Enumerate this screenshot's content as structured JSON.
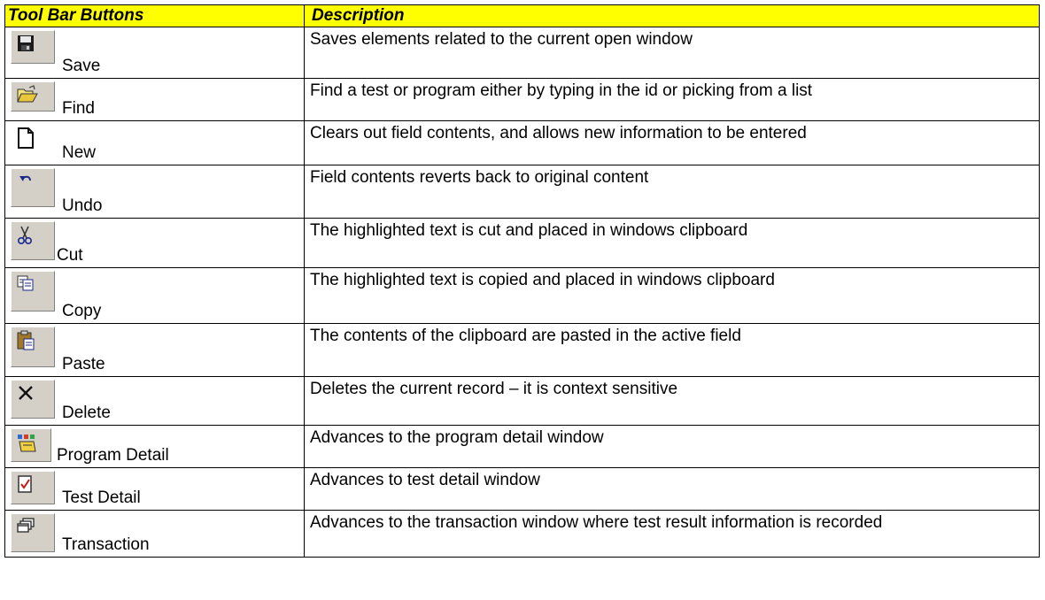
{
  "header": {
    "col_tool": "Tool Bar Buttons",
    "col_desc": "Description"
  },
  "rows": [
    {
      "name": "Save",
      "icon": "floppy-disk-icon",
      "desc": "Saves elements related to the current open window"
    },
    {
      "name": "Find",
      "icon": "open-folder-icon",
      "desc": "Find a test or program either by typing in the id or picking from a list"
    },
    {
      "name": "New",
      "icon": "new-document-icon",
      "desc": "Clears out field contents, and allows new information to be entered"
    },
    {
      "name": "Undo",
      "icon": "undo-arrow-icon",
      "desc": "Field contents reverts back to original content"
    },
    {
      "name": "Cut",
      "icon": "scissors-icon",
      "desc": "The highlighted text is cut and placed in windows clipboard"
    },
    {
      "name": "Copy",
      "icon": "copy-pages-icon",
      "desc": "The highlighted text is copied and placed in windows clipboard"
    },
    {
      "name": "Paste",
      "icon": "clipboard-paste-icon",
      "desc": "The contents of the clipboard are pasted in the active field"
    },
    {
      "name": "Delete",
      "icon": "delete-x-icon",
      "desc": "Deletes the current record – it is context sensitive"
    },
    {
      "name": "Program Detail",
      "icon": "program-detail-icon",
      "desc": "Advances to the program detail window"
    },
    {
      "name": "Test Detail",
      "icon": "checklist-icon",
      "desc": "Advances to test detail window"
    },
    {
      "name": "Transaction",
      "icon": "stacked-windows-icon",
      "desc": "Advances to the transaction window where test result information is recorded"
    }
  ],
  "colors": {
    "header_bg": "#ffff00",
    "button_face": "#d4d0c8"
  }
}
